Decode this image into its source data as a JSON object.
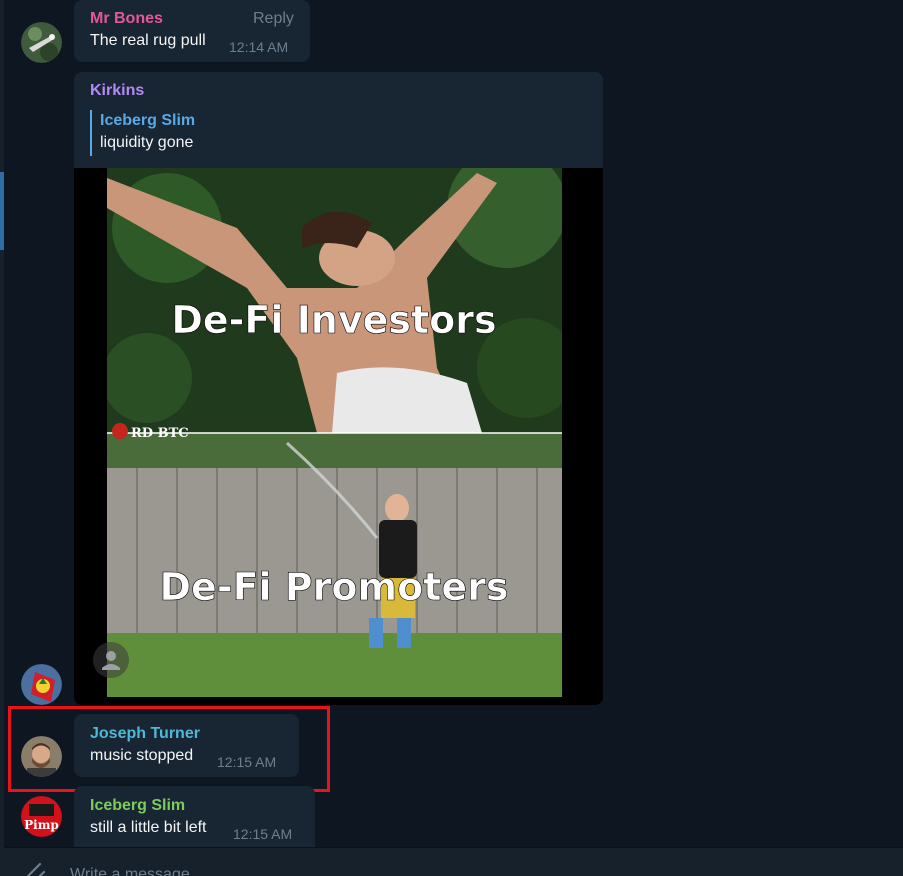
{
  "colors": {
    "background": "#0e1621",
    "bubble": "#182533",
    "timestamp": "#6d7f8f",
    "highlight_box": "#e8141b"
  },
  "messages": [
    {
      "sender": "Mr Bones",
      "sender_color": "#e3589a",
      "text": "The real rug pull",
      "time": "12:14 AM",
      "action": "Reply",
      "avatar_icon": "bones-avatar-icon"
    },
    {
      "sender": "Kirkins",
      "sender_color": "#b38af5",
      "quote": {
        "name": "Iceberg Slim",
        "text": "liquidity gone"
      },
      "media": {
        "top_caption": "De-Fi Investors",
        "watermark": "RD BTC",
        "bottom_caption": "De-Fi Promoters"
      },
      "avatar_icon": "kirkins-avatar-icon"
    },
    {
      "sender": "Joseph Turner",
      "sender_color": "#4fb8d6",
      "text": "music stopped",
      "time": "12:15 AM",
      "avatar_icon": "joseph-avatar-icon"
    },
    {
      "sender": "Iceberg Slim",
      "sender_color": "#7ccc5b",
      "text": "still a little bit left",
      "time": "12:15 AM",
      "avatar_icon": "iceberg-avatar-icon",
      "avatar_text": "Pimp"
    }
  ],
  "composer": {
    "placeholder": "Write a message..."
  }
}
